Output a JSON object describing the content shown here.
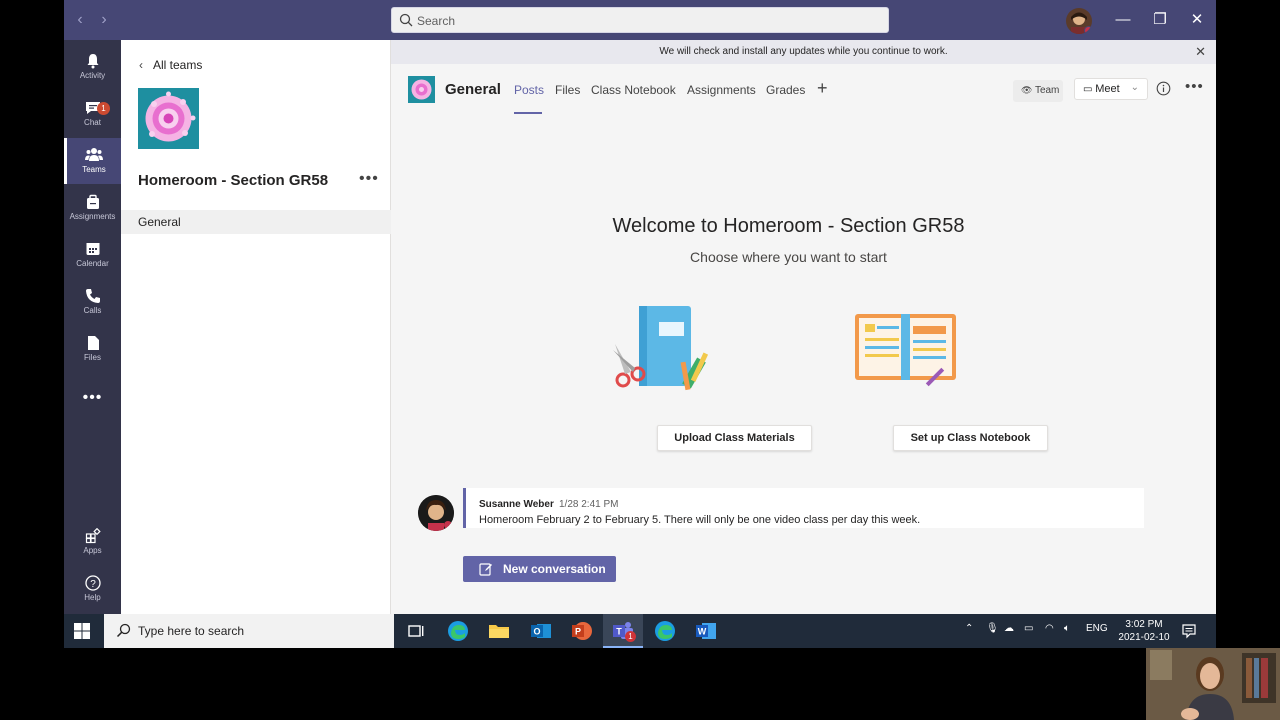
{
  "titlebar": {
    "search_placeholder": "Search",
    "back_icon": "chevron-left-icon",
    "forward_icon": "chevron-right-icon"
  },
  "rail": {
    "items": [
      {
        "label": "Activity",
        "icon": "bell-icon"
      },
      {
        "label": "Chat",
        "icon": "chat-icon",
        "badge": "1"
      },
      {
        "label": "Teams",
        "icon": "teams-icon",
        "active": true
      },
      {
        "label": "Assignments",
        "icon": "assignments-icon"
      },
      {
        "label": "Calendar",
        "icon": "calendar-icon"
      },
      {
        "label": "Calls",
        "icon": "phone-icon"
      },
      {
        "label": "Files",
        "icon": "file-icon"
      },
      {
        "label": "Apps",
        "icon": "apps-icon"
      },
      {
        "label": "Help",
        "icon": "help-icon"
      }
    ]
  },
  "teampanel": {
    "back_label": "All teams",
    "team_name": "Homeroom - Section GR58",
    "channels": [
      "General"
    ]
  },
  "main": {
    "update_notice": "We will check and install any updates while you continue to work.",
    "channel_title": "General",
    "tabs": [
      "Posts",
      "Files",
      "Class Notebook",
      "Assignments",
      "Grades"
    ],
    "team_button": "Team",
    "meet_button": "Meet",
    "welcome_title": "Welcome to Homeroom - Section GR58",
    "welcome_subtitle": "Choose where you want to start",
    "upload_button": "Upload Class Materials",
    "notebook_button": "Set up Class Notebook",
    "message": {
      "author": "Susanne Weber",
      "time": "1/28 2:41 PM",
      "text": "Homeroom February 2 to February 5.  There will only be one video class per day this week."
    },
    "new_conversation": "New conversation"
  },
  "taskbar": {
    "search_placeholder": "Type here to search",
    "language": "ENG",
    "time": "3:02 PM",
    "date": "2021-02-10",
    "teams_badge": "1"
  },
  "colors": {
    "titlebar": "#464775",
    "rail": "#33344a",
    "accent": "#6264a7",
    "taskbar": "#202b3a"
  }
}
